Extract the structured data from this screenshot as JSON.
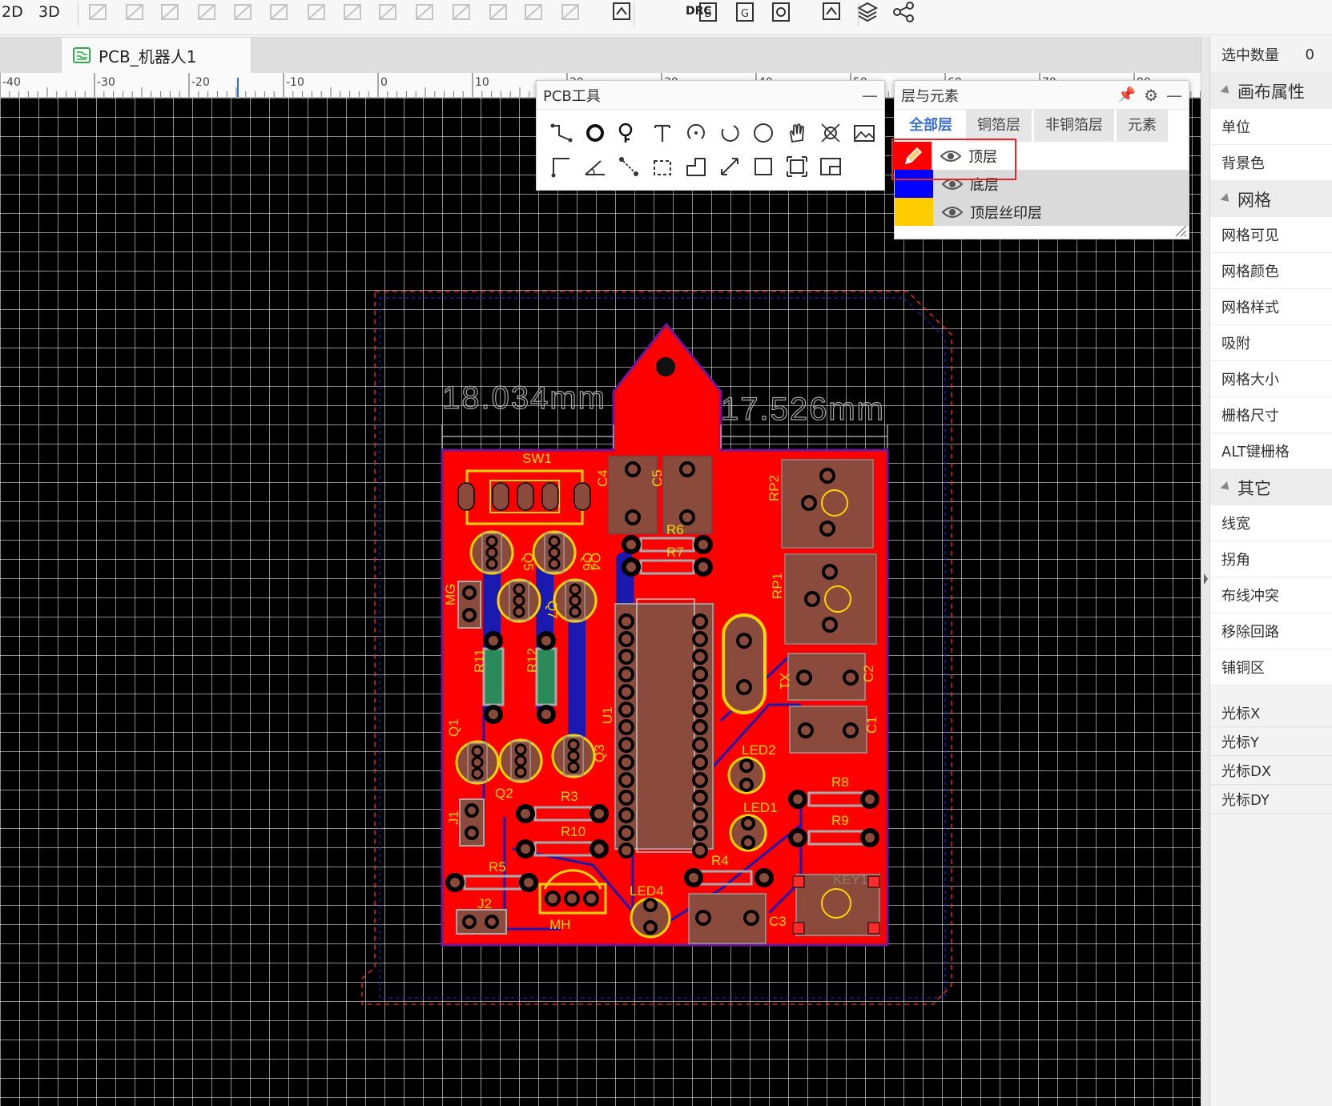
{
  "toolbar": {
    "view_2d": "2D",
    "view_3d": "3D",
    "drc_label": "DRC",
    "icons": [
      "rotate-icon",
      "flip-icon",
      "mirror-icon",
      "flip-h-icon",
      "align-left-icon",
      "align-right-icon",
      "align-top-icon",
      "align-bottom-icon",
      "align-center-v-icon",
      "align-center-h-icon",
      "distribute-icon",
      "distribute-v-icon",
      "distribute-h-icon",
      "group-icon",
      "import-changes-icon",
      "drc-icon",
      "board-b-icon",
      "board-g-icon",
      "settings-board-icon",
      "photo-view-icon",
      "layers-icon",
      "share-icon"
    ]
  },
  "document": {
    "tab_title": "PCB_机器人1"
  },
  "ruler": {
    "labels": [
      "-40",
      "-30",
      "-20",
      "-10",
      "0",
      "10",
      "20",
      "30",
      "40",
      "50",
      "60",
      "70",
      "80"
    ]
  },
  "pcb_tools": {
    "title": "PCB工具",
    "tools": [
      "track-icon",
      "via-icon",
      "pad-icon",
      "text-icon",
      "arc-center-icon",
      "arc-3pt-icon",
      "circle-icon",
      "pan-hand-icon",
      "hole-icon",
      "image-icon",
      "corner-track-icon",
      "angle-dim-icon",
      "connect-pad-icon",
      "rect-select-icon",
      "polygon-icon",
      "dimension-icon",
      "rectangle-icon",
      "copper-region-icon",
      "board-outline-icon"
    ]
  },
  "layers_panel": {
    "title": "层与元素",
    "tabs": [
      "全部层",
      "铜箔层",
      "非铜箔层",
      "元素"
    ],
    "active_tab": "全部层",
    "layers": [
      {
        "name": "顶层",
        "color": "#ff0000",
        "active": true
      },
      {
        "name": "底层",
        "color": "#0000ff",
        "active": false
      },
      {
        "name": "顶层丝印层",
        "color": "#ffcc00",
        "active": false
      }
    ]
  },
  "board": {
    "dim_left": "18.034mm",
    "dim_right": "17.526mm",
    "labels": {
      "sw1": "SW1",
      "c4": "C4",
      "c5": "C5",
      "r6": "R6",
      "r7": "R7",
      "rp2": "RP2",
      "rp1": "RP1",
      "q5": "Q5",
      "q6": "Q6",
      "q7": "Q7",
      "q4": "Q4",
      "mg": "MG",
      "r11": "R11",
      "r12": "R12",
      "u1": "U1",
      "x1": "X1",
      "c2": "C2",
      "c1": "C1",
      "led2": "LED2",
      "led1": "LED1",
      "q1": "Q1",
      "q2": "Q2",
      "q3": "Q3",
      "r3": "R3",
      "r8": "R8",
      "r9": "R9",
      "j1": "J1",
      "r10": "R10",
      "r5": "R5",
      "r4": "R4",
      "led4": "LED4",
      "j2": "J2",
      "mh": "MH",
      "c3": "C3",
      "key1": "KEY1"
    },
    "colors": {
      "top_copper": "#ff0000",
      "bottom": "#0000ff",
      "silk": "#ffcc00",
      "pad": "#8a4a3c",
      "outline": "#7a1fa0"
    }
  },
  "properties": {
    "selected_label": "选中数量",
    "selected_count": "0",
    "sections": [
      {
        "title": "画布属性",
        "items": [
          "单位",
          "背景色"
        ]
      },
      {
        "title": "网格",
        "items": [
          "网格可见",
          "网格颜色",
          "网格样式",
          "吸附",
          "网格大小",
          "栅格尺寸",
          "ALT键栅格"
        ]
      },
      {
        "title": "其它",
        "items": [
          "线宽",
          "拐角",
          "布线冲突",
          "移除回路",
          "铺铜区"
        ]
      }
    ],
    "cursor": [
      "光标X",
      "光标Y",
      "光标DX",
      "光标DY"
    ]
  }
}
